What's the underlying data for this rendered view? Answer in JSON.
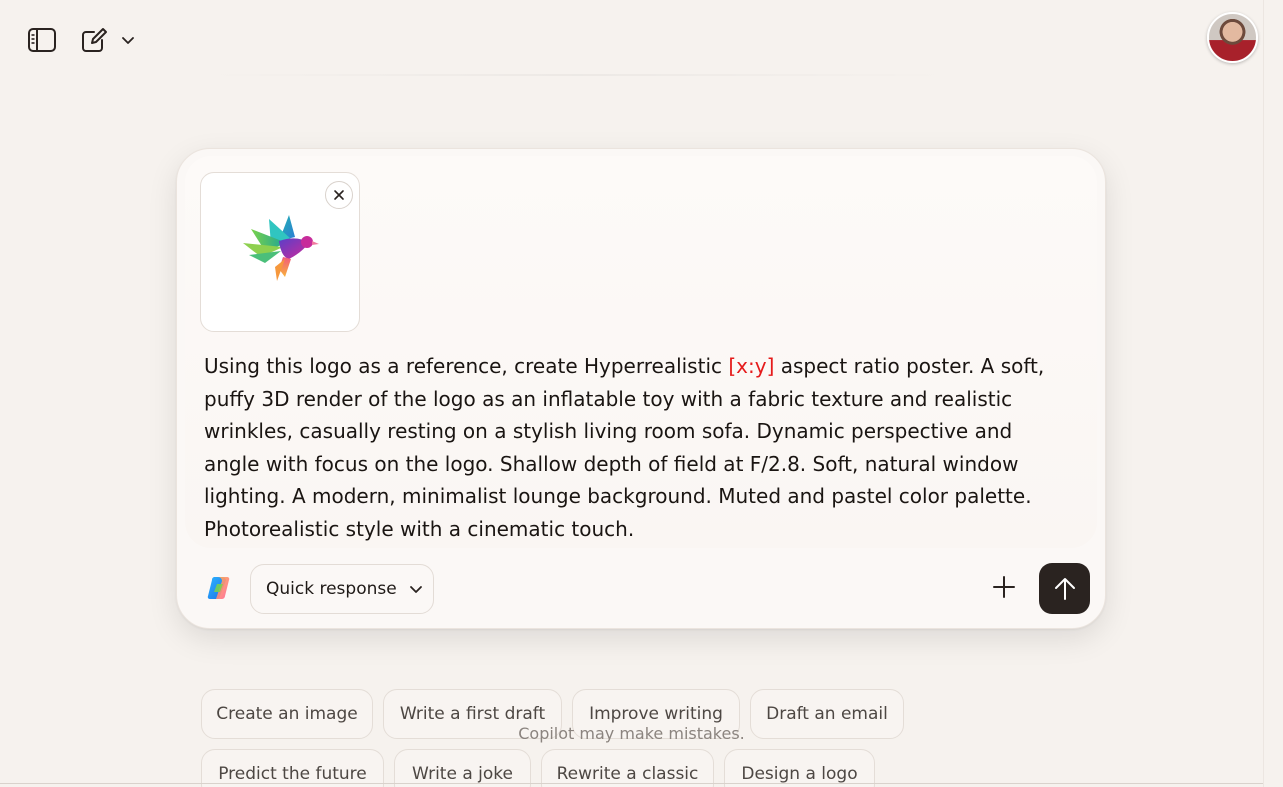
{
  "topbar": {
    "sidebar_toggle_icon": "sidebar-icon",
    "new_chat_icon": "compose-icon",
    "dropdown_icon": "chevron-down-icon"
  },
  "composer": {
    "attachment": {
      "type": "image",
      "description_icon": "bird-logo"
    },
    "prompt_before": "Using this logo as a reference, create Hyperrealistic ",
    "prompt_highlight": "[x:y]",
    "prompt_after": " aspect ratio poster. A soft, puffy 3D render of the logo as an inflatable toy with a fabric texture and realistic wrinkles, casually resting on a stylish living room sofa. Dynamic perspective and angle with focus on the logo. Shallow depth of field at F/2.8. Soft, natural window lighting. A modern, minimalist lounge background. Muted and pastel color palette. Photorealistic style with a cinematic touch.",
    "mode_label": "Quick response",
    "send_icon": "arrow-up-icon",
    "add_icon": "plus-icon"
  },
  "suggestions": [
    "Create an image",
    "Write a first draft",
    "Improve writing",
    "Draft an email",
    "Predict the future",
    "Write a joke",
    "Rewrite a classic",
    "Design a logo"
  ],
  "disclaimer": "Copilot may make mistakes.",
  "colors": {
    "highlight": "#e51b1b",
    "send_button": "#2a2320",
    "background": "#f6f2ee"
  }
}
